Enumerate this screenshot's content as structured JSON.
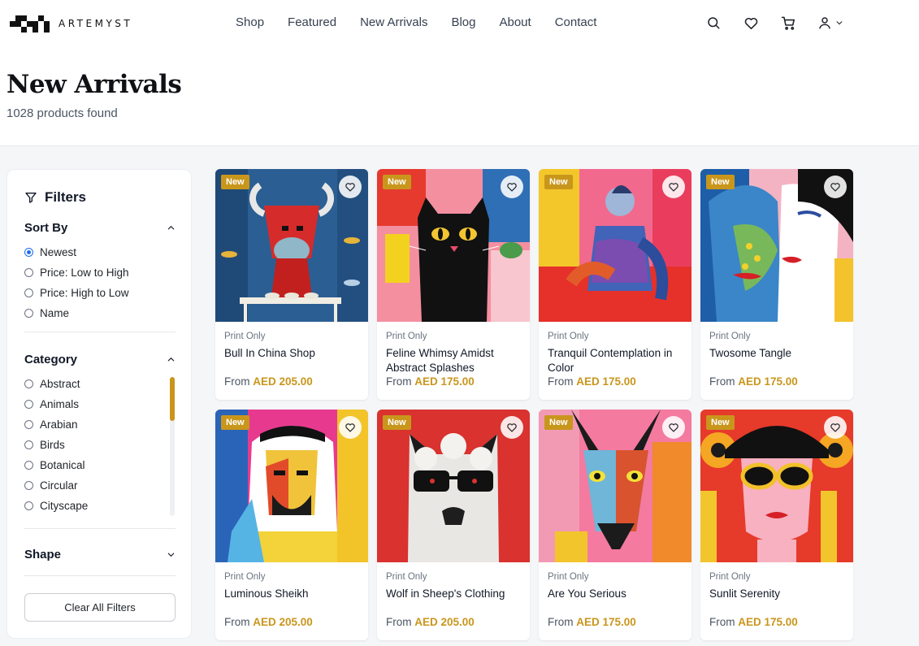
{
  "brand": {
    "name": "ARTEMYST"
  },
  "nav": [
    "Shop",
    "Featured",
    "New Arrivals",
    "Blog",
    "About",
    "Contact"
  ],
  "header_icons": [
    "search-icon",
    "heart-icon",
    "cart-icon",
    "user-icon",
    "chevron-down-icon"
  ],
  "page": {
    "title": "New Arrivals",
    "count_text": "1028 products found"
  },
  "filters": {
    "title": "Filters",
    "sort": {
      "title": "Sort By",
      "options": [
        "Newest",
        "Price: Low to High",
        "Price: High to Low",
        "Name"
      ],
      "selected": "Newest"
    },
    "category": {
      "title": "Category",
      "options": [
        "Abstract",
        "Animals",
        "Arabian",
        "Birds",
        "Botanical",
        "Circular",
        "Cityscape"
      ]
    },
    "shape": {
      "title": "Shape"
    },
    "clear_label": "Clear All Filters"
  },
  "products": [
    {
      "badge": "New",
      "type": "Print Only",
      "name": "Bull In China Shop",
      "price_prefix": "From",
      "price": "AED 205.00"
    },
    {
      "badge": "New",
      "type": "Print Only",
      "name": "Feline Whimsy Amidst Abstract Splashes",
      "price_prefix": "From",
      "price": "AED 175.00"
    },
    {
      "badge": "New",
      "type": "Print Only",
      "name": "Tranquil Contemplation in Color",
      "price_prefix": "From",
      "price": "AED 175.00"
    },
    {
      "badge": "New",
      "type": "Print Only",
      "name": "Twosome Tangle",
      "price_prefix": "From",
      "price": "AED 175.00"
    },
    {
      "badge": "New",
      "type": "Print Only",
      "name": "Luminous Sheikh",
      "price_prefix": "From",
      "price": "AED 205.00"
    },
    {
      "badge": "New",
      "type": "Print Only",
      "name": "Wolf in Sheep's Clothing",
      "price_prefix": "From",
      "price": "AED 205.00"
    },
    {
      "badge": "New",
      "type": "Print Only",
      "name": "Are You Serious",
      "price_prefix": "From",
      "price": "AED 175.00"
    },
    {
      "badge": "New",
      "type": "Print Only",
      "name": "Sunlit Serenity",
      "price_prefix": "From",
      "price": "AED 175.00"
    }
  ],
  "colors": {
    "accent": "#c9961c",
    "radio_selected": "#1f6feb",
    "text": "#1f2328",
    "background": "#f5f6f8"
  }
}
